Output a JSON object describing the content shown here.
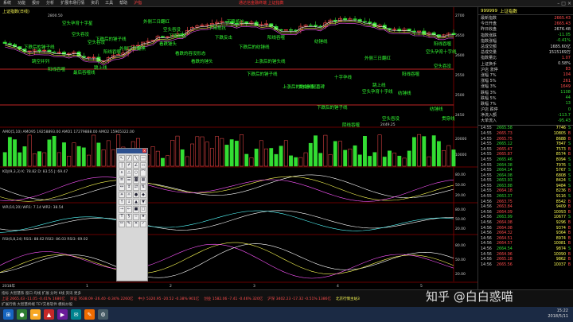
{
  "menu": {
    "items": [
      "系统",
      "功能",
      "报价",
      "分析",
      "扩展市场行情",
      "资讯",
      "工具",
      "帮助",
      "沪指"
    ],
    "active_index": 8,
    "title": "通达信金融终端 上证指数",
    "window_buttons": [
      "–",
      "□",
      "×"
    ]
  },
  "chart": {
    "header_label": "上证指数(日线)",
    "top_price_label": "2800.50",
    "low_price_label": "2449.25",
    "price_axis": [
      "2700",
      "2650",
      "2600",
      "2550",
      "2500",
      "2450"
    ],
    "vol_header": "AMO(5,10) AMO95 19258893.00 AMO1 17279888.00 AMO2 15965322.00",
    "vol_axis": [
      "20000",
      "10000"
    ],
    "kdj_header": "KDJ(9,3,3) K: 78.82 D: 83.55 J: 69.47",
    "kdj_axis": [
      "80.00",
      "50.00",
      "20.00"
    ],
    "wr_header": "WR(10,20) WR1: 7.14 WR2: 38.54",
    "wr_axis": [
      "80.00",
      "50.00",
      "20.00"
    ],
    "rsi_header": "RSI(6,8,24) RSI1: 88.62 RSI2: 86.03 RSI3: 69.02",
    "rsi_axis": [
      "80.00",
      "50.00",
      "20.00"
    ],
    "x_axis": [
      "2018年",
      "1",
      "2",
      "3",
      "4",
      "5"
    ],
    "annotations": [
      "空头孕育十字星",
      "外侧三日翻红",
      "下降抵抗",
      "空头吞没",
      "下跌后的锤子线",
      "下跌后的锤子线",
      "跳空并列",
      "阳线吞噬",
      "空头吞没",
      "外侧三日翻黑",
      "下降抵抗",
      "下跌反击",
      "阳线吞噬",
      "看跌锤头",
      "跳上线",
      "最后吞噬线",
      "看跌的吞没形态",
      "看跌的锤头",
      "上涨后的锤头线",
      "下跌后的锤子线",
      "纺锤线",
      "外侧三日翻红",
      "空头孕育十字线",
      "空头吞没",
      "上涨后的纺锤线",
      "纺锤线",
      "十字孕线",
      "阳线吞噬",
      "阳线吞噬",
      "下跌后的锤子线",
      "类似长腿墓碑",
      "跳上线",
      "空头孕育十字线",
      "阳线吞噬",
      "下跌后的纺锤线",
      "下降抵抗",
      "阴线吞噬",
      "空头吞没",
      "空头吞没",
      "纺锤线",
      "贯穿线"
    ]
  },
  "quote": {
    "code": "999999",
    "name": "上证指数",
    "rows": [
      {
        "label": "最新指数",
        "value": "2665.43",
        "color": "red"
      },
      {
        "label": "今日开盘",
        "value": "2665.43",
        "color": "red"
      },
      {
        "label": "昨日收盘",
        "value": "2676.48",
        "color": "white"
      },
      {
        "label": "指数涨跌",
        "value": "-11.05",
        "color": "green"
      },
      {
        "label": "指数涨幅",
        "value": "-0.41%",
        "color": "green"
      },
      {
        "label": "总成交额",
        "value": "1685.60亿",
        "color": "white"
      },
      {
        "label": "总成交量",
        "value": "1515169万",
        "color": "white"
      },
      {
        "label": "指数量比",
        "value": "1.07",
        "color": "red"
      },
      {
        "label": "上证换手",
        "value": "0.58%",
        "color": "white"
      },
      {
        "label": "沪店 涨停",
        "value": "83",
        "color": "red"
      },
      {
        "label": "涨幅 7%",
        "value": "104",
        "color": "red"
      },
      {
        "label": "涨幅 5%",
        "value": "261",
        "color": "red"
      },
      {
        "label": "涨幅 3%",
        "value": "1649",
        "color": "red"
      },
      {
        "label": "跌幅 3%",
        "value": "1108",
        "color": "green"
      },
      {
        "label": "跌幅 5%",
        "value": "44",
        "color": "green"
      },
      {
        "label": "跌幅 7%",
        "value": "13",
        "color": "green"
      },
      {
        "label": "沪店 跌停",
        "value": "0",
        "color": "green"
      },
      {
        "label": "净流入额",
        "value": "-113.7",
        "color": "green"
      },
      {
        "label": "大单流入",
        "value": "-95.43",
        "color": "green"
      }
    ],
    "ticks": [
      {
        "time": "14:55",
        "price": "2665.58",
        "vol": "7746",
        "dir": "S"
      },
      {
        "time": "14:55",
        "price": "2665.73",
        "vol": "10805",
        "dir": "B"
      },
      {
        "time": "14:55",
        "price": "2665.75",
        "vol": "8688",
        "dir": "B"
      },
      {
        "time": "14:55",
        "price": "2665.12",
        "vol": "7847",
        "dir": "S"
      },
      {
        "time": "14:55",
        "price": "2665.47",
        "vol": "7573",
        "dir": "B"
      },
      {
        "time": "14:55",
        "price": "2665.87",
        "vol": "8574",
        "dir": "B"
      },
      {
        "time": "14:55",
        "price": "2665.46",
        "vol": "8094",
        "dir": "S"
      },
      {
        "time": "14:55",
        "price": "2664.38",
        "vol": "7976",
        "dir": "S"
      },
      {
        "time": "14:55",
        "price": "2664.14",
        "vol": "5767",
        "dir": "S"
      },
      {
        "time": "14:55",
        "price": "2664.08",
        "vol": "6808",
        "dir": "S"
      },
      {
        "time": "14:55",
        "price": "2663.93",
        "vol": "8424",
        "dir": "S"
      },
      {
        "time": "14:55",
        "price": "2663.88",
        "vol": "9484",
        "dir": "S"
      },
      {
        "time": "14:55",
        "price": "2664.18",
        "vol": "8236",
        "dir": "B"
      },
      {
        "time": "14:55",
        "price": "2663.37",
        "vol": "9116",
        "dir": "S"
      },
      {
        "time": "14:56",
        "price": "2663.75",
        "vol": "8542",
        "dir": "B"
      },
      {
        "time": "14:56",
        "price": "2663.84",
        "vol": "9409",
        "dir": "B"
      },
      {
        "time": "14:56",
        "price": "2664.09",
        "vol": "10093",
        "dir": "B"
      },
      {
        "time": "14:56",
        "price": "2663.99",
        "vol": "10677",
        "dir": "S"
      },
      {
        "time": "14:56",
        "price": "2664.08",
        "vol": "9296",
        "dir": "B"
      },
      {
        "time": "14:56",
        "price": "2664.08",
        "vol": "9374",
        "dir": "B"
      },
      {
        "time": "14:56",
        "price": "2664.32",
        "vol": "9364",
        "dir": "B"
      },
      {
        "time": "14:56",
        "price": "2664.51",
        "vol": "8974",
        "dir": "B"
      },
      {
        "time": "14:56",
        "price": "2664.57",
        "vol": "10081",
        "dir": "B"
      },
      {
        "time": "14:56",
        "price": "2664.54",
        "vol": "9874",
        "dir": "S"
      },
      {
        "time": "14:56",
        "price": "2664.96",
        "vol": "10090",
        "dir": "B"
      },
      {
        "time": "14:56",
        "price": "2665.18",
        "vol": "9862",
        "dir": "B"
      },
      {
        "time": "14:56",
        "price": "2665.56",
        "vol": "10037",
        "dir": "B"
      }
    ]
  },
  "status": {
    "line1": "指标  大智慧系  窗口  均线  扩展  分时  K线  资讯  更多",
    "line2a": "上证 2665.43 -11.05 -0.41% 1686亿",
    "line2b": "深证 7638.09 -26.40 -0.34% 2260亿",
    "line2c": "中小 5320.95 -20.52 -0.38% 901亿",
    "line2d": "创业 1582.06 -7.41 -0.46% 320亿",
    "line2e": "沪深 3402.23 -17.32 -0.51% 1386亿",
    "line2f": "北京行情主站3",
    "line3": "扩展行情  大智慧终端  TEY交易软件  模拟炒股"
  },
  "watermark": "知乎 @白白惑喵",
  "clock": {
    "time": "15:22",
    "date": "2018/5/11"
  },
  "colors": {
    "up": "#ff4d4d",
    "down": "#33dd33",
    "label": "#ffff55",
    "bg": "#000000"
  },
  "draw_tools": [
    "↖",
    "╱",
    "╲",
    "—",
    "│",
    "↱",
    "∠",
    "▭",
    "∧",
    "△",
    "○",
    "⌒",
    "≡",
    "☰",
    "▓",
    "▦",
    "↔",
    "↕",
    "⇄",
    "⇅",
    "☀",
    "☼",
    "●",
    "◆",
    "↑",
    "↓",
    "▲",
    "▼",
    "→",
    "←",
    "■",
    "□",
    "T",
    "§",
    "☆",
    "★",
    "✂",
    "✎",
    "✕",
    "✓"
  ]
}
